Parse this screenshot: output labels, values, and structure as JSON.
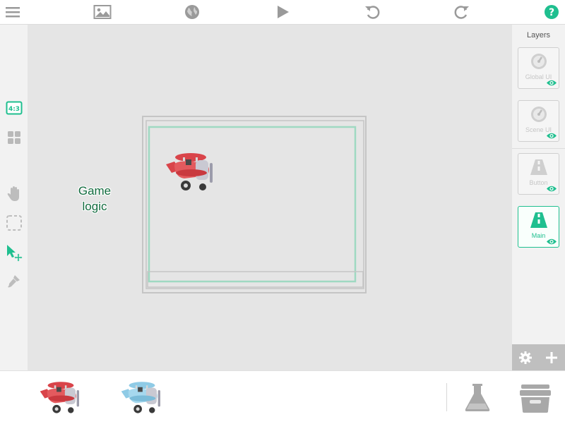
{
  "toolbar": {
    "items": [
      "menu-icon",
      "image-icon",
      "globe-icon",
      "play-icon",
      "undo-icon",
      "redo-icon",
      "help-icon"
    ],
    "accent_color": "#1fbf8f"
  },
  "left_tools": {
    "aspect_label": "4:3",
    "items": [
      "aspect-ratio-icon",
      "grid-icon",
      "hand-icon",
      "select-box-icon",
      "move-arrow-icon",
      "brush-icon"
    ]
  },
  "canvas": {
    "object_text": "Game\nlogic",
    "object_text_line1": "Game",
    "object_text_line2": "logic",
    "sprite": "red-airplane-icon"
  },
  "layers": {
    "title": "Layers",
    "items": [
      {
        "name": "Global UI",
        "icon": "gauge-icon",
        "visible": true,
        "active": false
      },
      {
        "name": "Scene UI",
        "icon": "gauge-icon",
        "visible": true,
        "active": false
      },
      {
        "name": "Button",
        "icon": "road-icon",
        "visible": true,
        "active": false
      },
      {
        "name": "Main",
        "icon": "road-icon",
        "visible": true,
        "active": true
      }
    ],
    "bottom_icons": [
      "gear-icon",
      "plus-icon"
    ]
  },
  "bottom": {
    "sprites": [
      "red-airplane-icon",
      "blue-airplane-icon"
    ],
    "right_icons": [
      "flask-icon",
      "archive-box-icon"
    ]
  }
}
